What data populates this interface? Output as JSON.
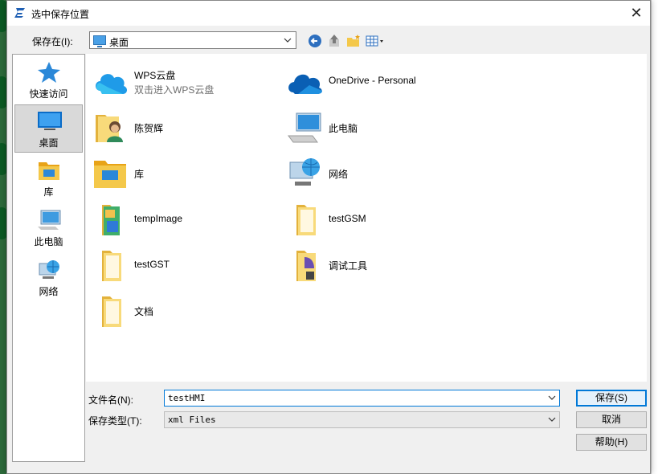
{
  "dialog": {
    "title": "选中保存位置",
    "close_glyph": "✕"
  },
  "toolbar": {
    "save_in_label": "保存在(I):",
    "save_in_value": "桌面",
    "back_icon": "back-arrow-icon",
    "up_icon": "up-folder-icon",
    "new_folder_icon": "new-folder-icon",
    "view_menu_icon": "view-menu-icon"
  },
  "places": [
    {
      "label": "快速访问",
      "icon": "star-icon"
    },
    {
      "label": "桌面",
      "icon": "desktop-icon",
      "selected": true
    },
    {
      "label": "库",
      "icon": "library-icon"
    },
    {
      "label": "此电脑",
      "icon": "computer-icon"
    },
    {
      "label": "网络",
      "icon": "network-icon"
    }
  ],
  "items": [
    {
      "name": "WPS云盘",
      "sub": "双击进入WPS云盘",
      "icon": "cloud-icon"
    },
    {
      "name": "OneDrive - Personal",
      "icon": "cloud-icon"
    },
    {
      "name": "陈贺辉",
      "icon": "user-folder-icon"
    },
    {
      "name": "此电脑",
      "icon": "computer-icon"
    },
    {
      "name": "库",
      "icon": "library-icon"
    },
    {
      "name": "网络",
      "icon": "network-icon"
    },
    {
      "name": "tempImage",
      "icon": "image-folder-icon"
    },
    {
      "name": "testGSM",
      "icon": "folder-icon"
    },
    {
      "name": "testGST",
      "icon": "folder-icon"
    },
    {
      "name": "调试工具",
      "icon": "tools-folder-icon"
    },
    {
      "name": "文档",
      "icon": "folder-icon"
    }
  ],
  "form": {
    "filename_label": "文件名(N):",
    "filename_value": "testHMI",
    "filetype_label": "保存类型(T):",
    "filetype_value": "xml Files"
  },
  "buttons": {
    "save": "保存(S)",
    "cancel": "取消",
    "help": "帮助(H)"
  },
  "colors": {
    "accent": "#0078d7",
    "folder": "#f4c84a",
    "selected_place": "#d9d9d9"
  }
}
